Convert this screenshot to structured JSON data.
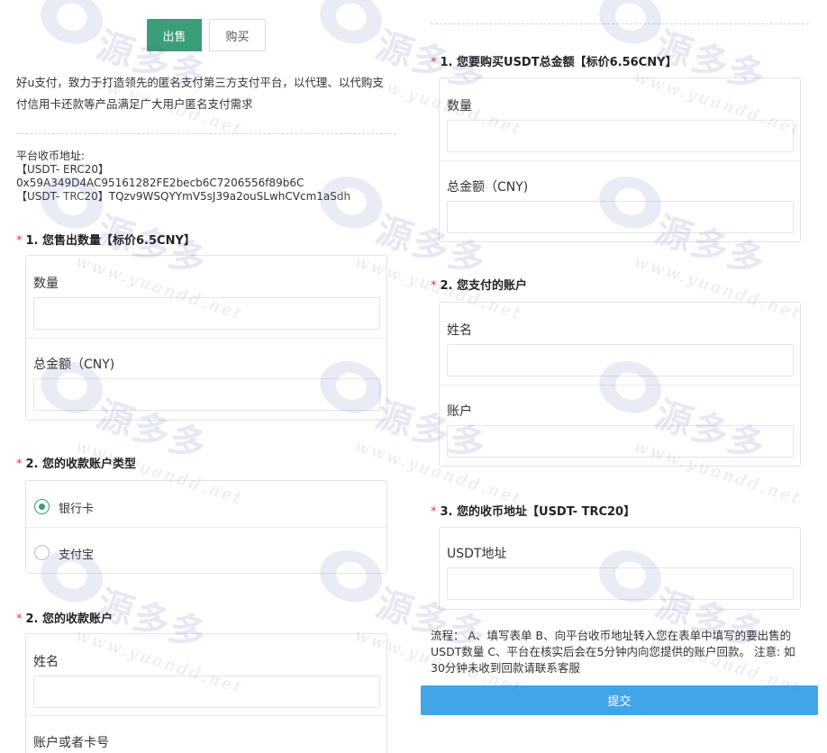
{
  "tabs": {
    "sell": "出售",
    "buy": "购买"
  },
  "intro": "好u支付，致力于打造领先的匿名支付第三方支付平台，以代理、以代购支付信用卡还款等产品满足广大用户匿名支付需求",
  "platform_address": {
    "label": "平台收币地址:",
    "erc20_tag": "【USDT- ERC20】",
    "erc20_address": "0x59A349D4AC95161282FE2becb6C7206556f89b6C",
    "trc20_line": "【USDT- TRC20】TQzv9WSQYYmV5sJ39a2ouSLwhCVcm1aSdh"
  },
  "sell_form": {
    "q1_title": "1. 您售出数量【标价6.5CNY】",
    "q1_qty_label": "数量",
    "q1_total_label": "总金额（CNY)",
    "q2_title": "2. 您的收款账户类型",
    "q2_options": [
      "银行卡",
      "支付宝"
    ],
    "q2_selected": "银行卡",
    "q3_title": "2. 您的收款账户",
    "q3_name_label": "姓名",
    "q3_account_label": "账户或者卡号"
  },
  "buy_form": {
    "q1_title": "1. 您要购买USDT总金额【标价6.56CNY】",
    "q1_qty_label": "数量",
    "q1_total_label": "总金额（CNY)",
    "q2_title": "2. 您支付的账户",
    "q2_name_label": "姓名",
    "q2_account_label": "账户",
    "q3_title": "3. 您的收币地址【USDT- TRC20】",
    "q3_addr_label": "USDT地址"
  },
  "flow_text": "流程： A、填写表单 B、向平台收币地址转入您在表单中填写的要出售的USDT数量 C、平台在核实后会在5分钟内向您提供的账户回款。 注意: 如30分钟未收到回款请联系客服",
  "submit_label": "提交",
  "required_mark": "*",
  "watermark": {
    "text": "源多多",
    "url": "www.yuandd.net",
    "sub": "YUANDD NET",
    "color": "#4a5fa8"
  },
  "colors": {
    "accent": "#3a9e79",
    "submit": "#41a5e8",
    "required": "#e33333"
  }
}
